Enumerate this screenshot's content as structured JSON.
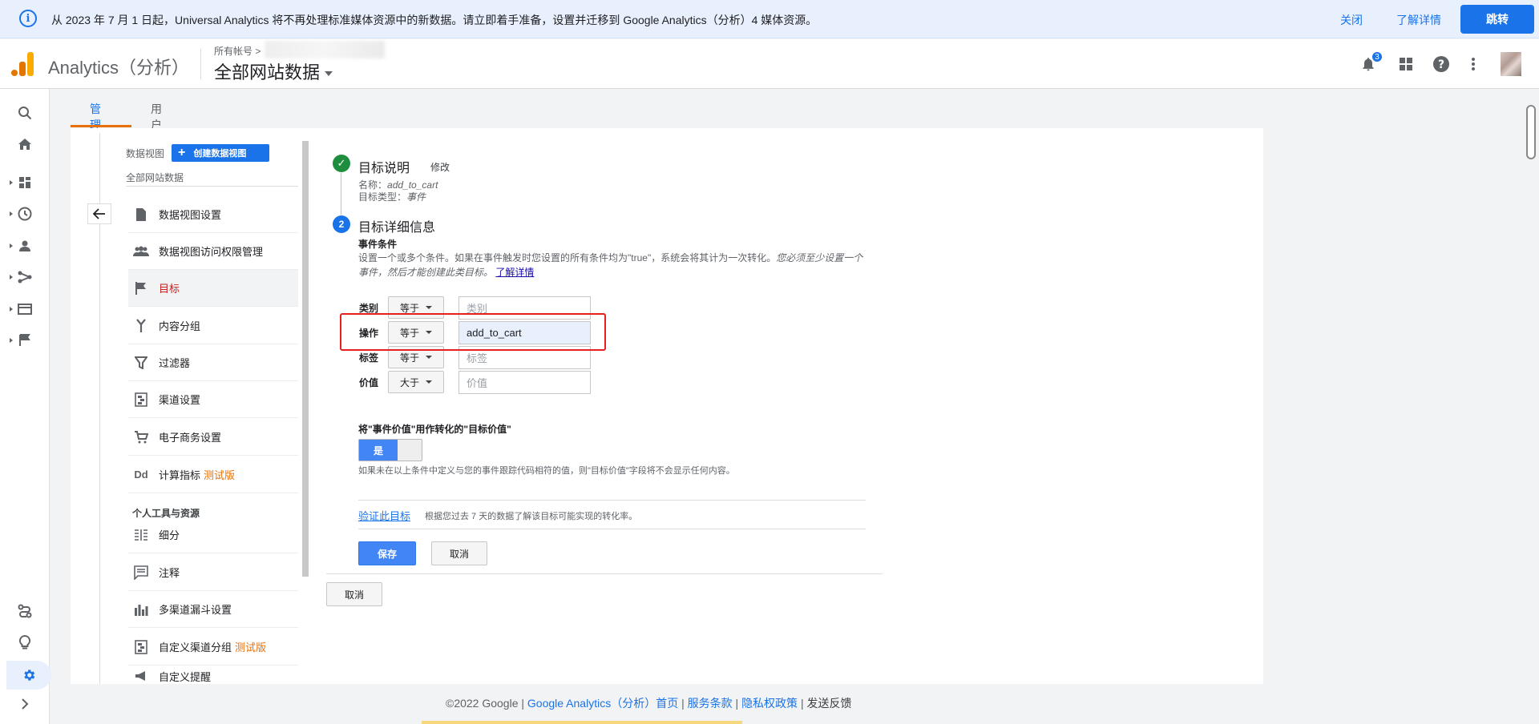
{
  "banner": {
    "message": "从 2023 年 7 月 1 日起，Universal Analytics 将不再处理标准媒体资源中的新数据。请立即着手准备，设置并迁移到 Google Analytics（分析）4 媒体资源。",
    "close_label": "关闭",
    "learn_more_label": "了解详情",
    "jump_label": "跳转"
  },
  "header": {
    "app_name": "Analytics（分析）",
    "account_label": "所有帐号 >",
    "property_name": "全部网站数据",
    "notification_count": "3"
  },
  "tabs": {
    "admin": "管理",
    "user": "用户"
  },
  "view": {
    "label": "数据视图",
    "create_button": "创建数据视图",
    "name": "全部网站数据"
  },
  "nav": {
    "items": [
      {
        "label": "数据视图设置",
        "icon": "document-icon"
      },
      {
        "label": "数据视图访问权限管理",
        "icon": "people-icon"
      },
      {
        "label": "目标",
        "icon": "flag-icon"
      },
      {
        "label": "内容分组",
        "icon": "merge-icon"
      },
      {
        "label": "过滤器",
        "icon": "filter-icon"
      },
      {
        "label": "渠道设置",
        "icon": "channel-icon"
      },
      {
        "label": "电子商务设置",
        "icon": "cart-icon"
      },
      {
        "label": "计算指标",
        "icon": "dd-icon",
        "badge": "测试版"
      }
    ],
    "personal_section": "个人工具与资源",
    "personal_items": [
      {
        "label": "细分",
        "icon": "segment-icon"
      },
      {
        "label": "注释",
        "icon": "comment-icon"
      },
      {
        "label": "多渠道漏斗设置",
        "icon": "bar-chart-icon"
      },
      {
        "label": "自定义渠道分组",
        "icon": "channel-icon",
        "badge": "测试版"
      },
      {
        "label": "自定义提醒",
        "icon": "megaphone-icon"
      }
    ],
    "active_index": 2
  },
  "goal": {
    "desc_title": "目标说明",
    "edit_label": "修改",
    "name_label": "名称：",
    "name_value": "add_to_cart",
    "type_label": "目标类型：",
    "type_value": "事件",
    "details_title": "目标详细信息",
    "step_number": "2",
    "conditions_title": "事件条件",
    "conditions_desc": "设置一个或多个条件。如果在事件触发时您设置的所有条件均为\"true\"，系统会将其计为一次转化。",
    "conditions_desc_italic": "您必须至少设置一个事件，然后才能创建此类目标。",
    "learn_more": "了解详情",
    "rows": [
      {
        "label": "类别",
        "operator": "等于",
        "value": "",
        "placeholder": "类别"
      },
      {
        "label": "操作",
        "operator": "等于",
        "value": "add_to_cart",
        "placeholder": ""
      },
      {
        "label": "标签",
        "operator": "等于",
        "value": "",
        "placeholder": "标签"
      },
      {
        "label": "价值",
        "operator": "大于",
        "value": "",
        "placeholder": "价值"
      }
    ],
    "use_value_title": "将\"事件价值\"用作转化的\"目标价值\"",
    "toggle_on_label": "是",
    "value_note": "如果未在以上条件中定义与您的事件跟踪代码相符的值，则\"目标价值\"字段将不会显示任何内容。",
    "verify_label": "验证此目标",
    "verify_note": "根据您过去 7 天的数据了解该目标可能实现的转化率。",
    "save_label": "保存",
    "cancel_label": "取消",
    "outer_cancel_label": "取消"
  },
  "footer": {
    "copyright": "©2022 Google",
    "sep": "|",
    "home": "Google Analytics（分析）首页",
    "terms": "服务条款",
    "privacy": "隐私权政策",
    "feedback": "发送反馈"
  },
  "colors": {
    "accent": "#1a73e8",
    "tab_underline": "#e8710a",
    "highlight": "#e52020",
    "done": "#1e8e3e"
  }
}
